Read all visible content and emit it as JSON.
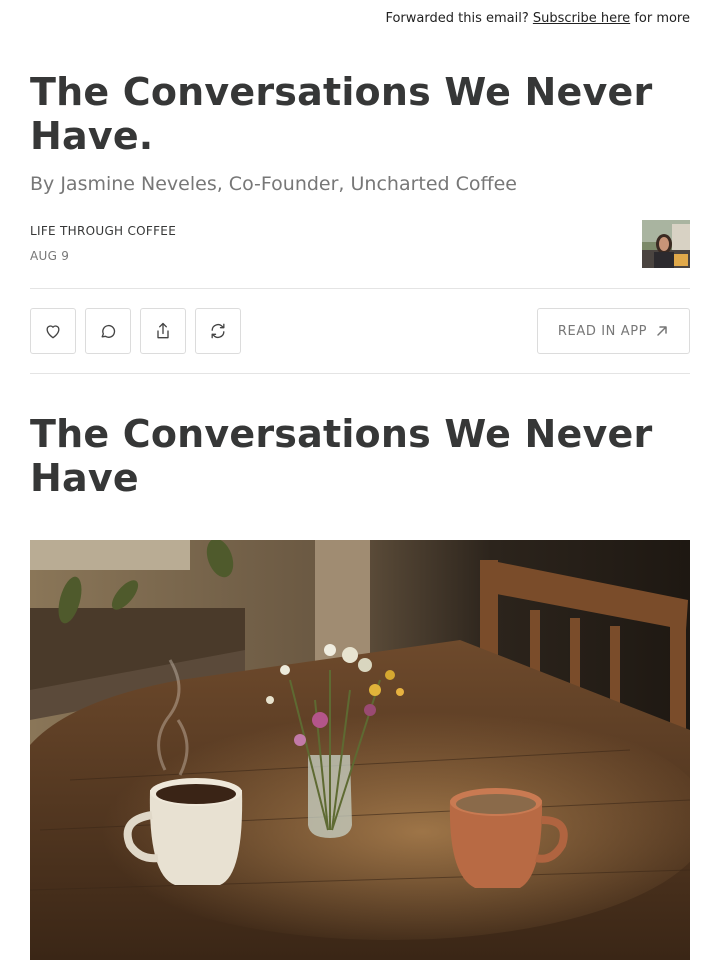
{
  "topbar": {
    "prefix": "Forwarded this email?",
    "link": "Subscribe here",
    "suffix": "for more"
  },
  "post": {
    "title": "The Conversations We Never Have.",
    "byline": "By Jasmine Neveles, Co-Founder, Uncharted Coffee",
    "publication": "LIFE THROUGH COFFEE",
    "date": "AUG 9"
  },
  "actions": {
    "icons": [
      "heart-icon",
      "comment-icon",
      "share-icon",
      "restack-icon"
    ],
    "read_in_app": "READ IN APP",
    "read_in_app_icon": "arrow-up-right-icon"
  },
  "content": {
    "heading": "The Conversations We Never Have"
  },
  "colors": {
    "text": "#363737",
    "muted": "#777777",
    "border": "#dcdcdc"
  }
}
